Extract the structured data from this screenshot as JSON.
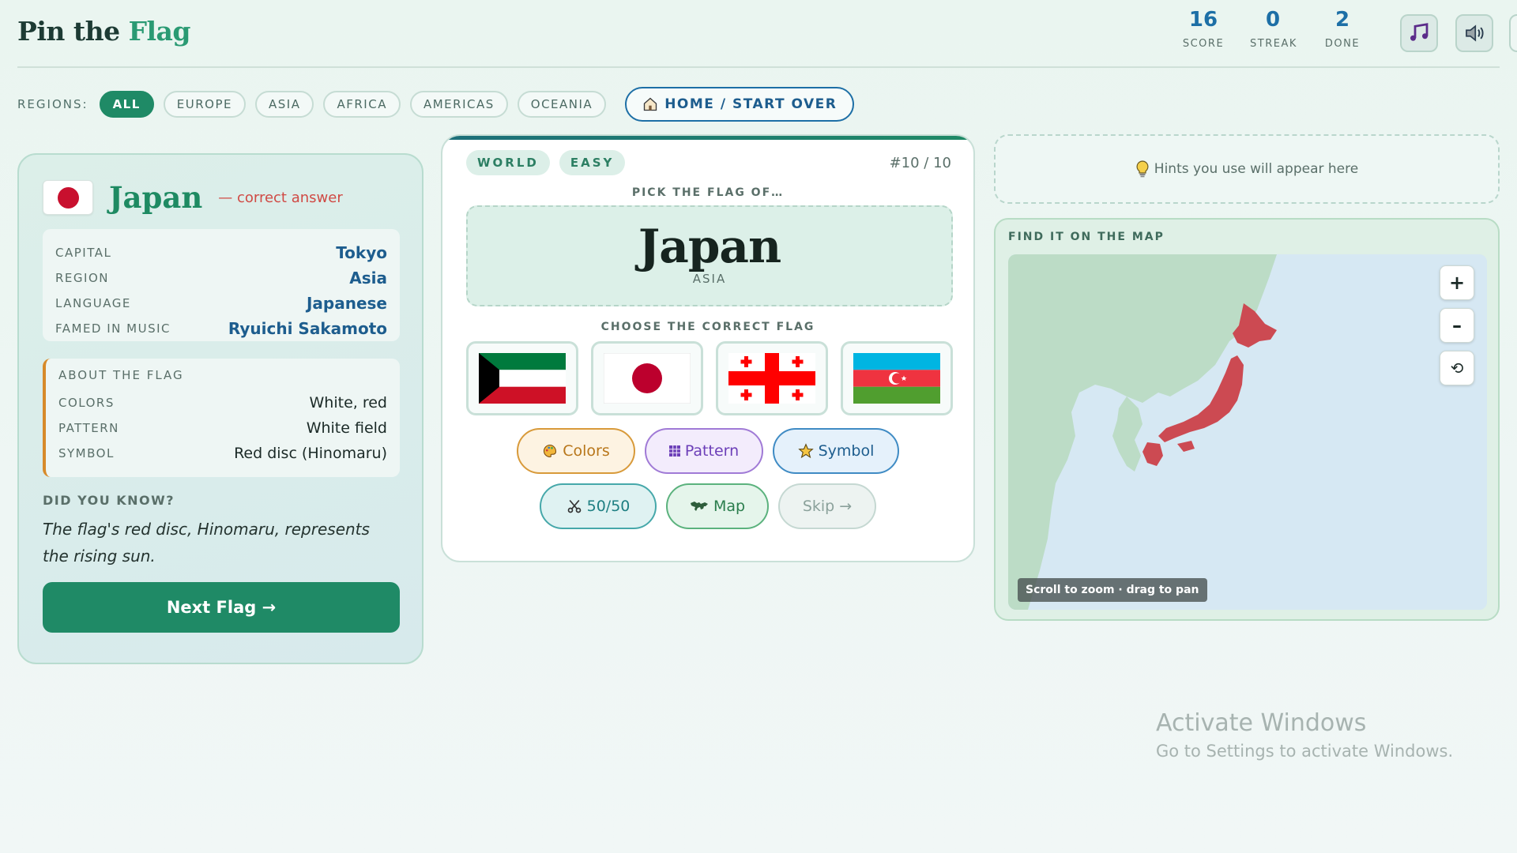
{
  "app": {
    "title_main": "Pin the ",
    "title_accent": "Flag"
  },
  "stats": [
    {
      "value": "16",
      "label": "SCORE"
    },
    {
      "value": "0",
      "label": "STREAK"
    },
    {
      "value": "2",
      "label": "DONE"
    }
  ],
  "header_buttons": {
    "music_icon": "music-note-icon",
    "sound_icon": "speaker-icon",
    "fullscreen_icon": "fullscreen-icon"
  },
  "regions": {
    "label": "REGIONS:",
    "items": [
      "ALL",
      "EUROPE",
      "ASIA",
      "AFRICA",
      "AMERICAS",
      "OCEANIA"
    ],
    "active": "ALL",
    "home_button": "HOME / START OVER"
  },
  "answer": {
    "country": "Japan",
    "note": "— correct answer",
    "facts": [
      {
        "key": "CAPITAL",
        "value": "Tokyo"
      },
      {
        "key": "REGION",
        "value": "Asia"
      },
      {
        "key": "LANGUAGE",
        "value": "Japanese"
      },
      {
        "key": "FAMED IN MUSIC",
        "value": "Ryuichi Sakamoto"
      }
    ],
    "about_title": "ABOUT THE FLAG",
    "about": [
      {
        "key": "COLORS",
        "value": "White, red"
      },
      {
        "key": "PATTERN",
        "value": "White field"
      },
      {
        "key": "SYMBOL",
        "value": "Red disc (Hinomaru)"
      }
    ],
    "did_you_know_title": "DID YOU KNOW?",
    "did_you_know": "The flag's red disc, Hinomaru, represents the rising sun.",
    "next_button": "Next Flag →"
  },
  "question": {
    "tags": [
      "WORLD",
      "EASY"
    ],
    "counter": "#10 / 10",
    "pick_label": "PICK THE FLAG OF…",
    "country": "Japan",
    "region": "ASIA",
    "choose_label": "CHOOSE THE CORRECT FLAG",
    "options": [
      "kuwait-flag",
      "japan-flag",
      "georgia-flag",
      "azerbaijan-flag"
    ]
  },
  "hints": {
    "colors": "Colors",
    "pattern": "Pattern",
    "symbol": "Symbol",
    "fifty": "50/50",
    "map": "Map",
    "skip": "Skip →"
  },
  "hint_panel": {
    "text": "Hints you use will appear here"
  },
  "map": {
    "title": "FIND IT ON THE MAP",
    "zoom_in": "+",
    "zoom_out": "–",
    "reset": "⟲",
    "tip": "Scroll to zoom · drag to pan",
    "highlight_color": "#cc4a52"
  },
  "watermark": {
    "line1": "Activate Windows",
    "line2": "Go to Settings to activate Windows."
  },
  "colors": {
    "brand_green": "#1f8a66",
    "brand_blue": "#1d6fa6",
    "answer_red": "#d04a45"
  }
}
